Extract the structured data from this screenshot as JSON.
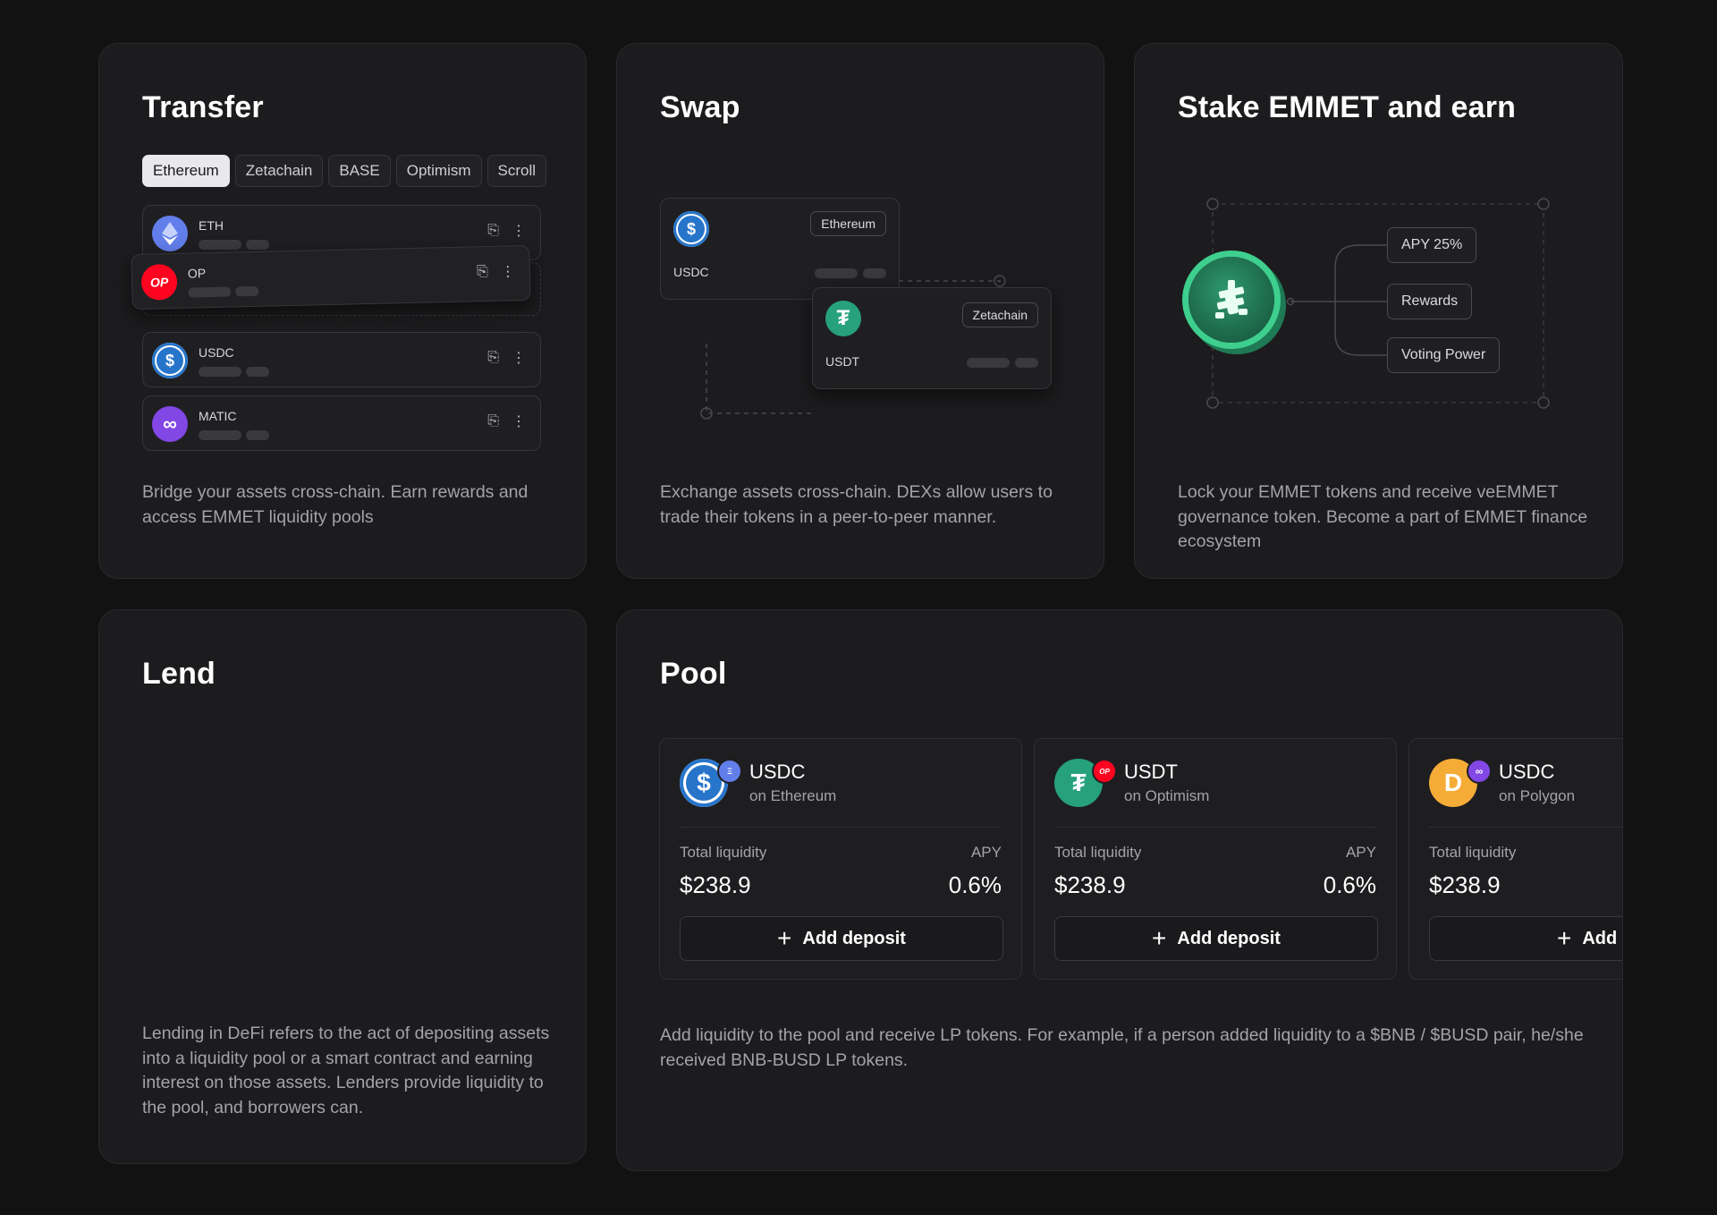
{
  "transfer": {
    "title": "Transfer",
    "tabs": [
      "Ethereum",
      "Zetachain",
      "BASE",
      "Optimism",
      "Scroll"
    ],
    "tokens": [
      {
        "symbol": "ETH",
        "logo": "Ξ"
      },
      {
        "symbol": "OP",
        "logo": "OP"
      },
      {
        "symbol": "USDC",
        "logo": "$"
      },
      {
        "symbol": "MATIC",
        "logo": "∞"
      }
    ],
    "description": "Bridge your assets cross-chain. Earn rewards and access EMMET liquidity pools"
  },
  "swap": {
    "title": "Swap",
    "from": {
      "symbol": "USDC",
      "network": "Ethereum",
      "logo": "$"
    },
    "to": {
      "symbol": "USDT",
      "network": "Zetachain",
      "logo": "₮"
    },
    "description": "Exchange assets cross-chain. DEXs allow users to trade their tokens in a peer-to-peer manner."
  },
  "stake": {
    "title": "Stake EMMET and earn",
    "benefits": [
      "APY 25%",
      "Rewards",
      "Voting Power"
    ],
    "description": "Lock your EMMET tokens and receive veEMMET governance token. Become a part of EMMET finance ecosystem"
  },
  "lend": {
    "title": "Lend",
    "description": "Lending in DeFi refers to the act of depositing assets into a liquidity pool or a smart contract and earning interest on those assets. Lenders provide liquidity to the pool, and borrowers can."
  },
  "pool": {
    "title": "Pool",
    "pools": [
      {
        "symbol": "USDC",
        "network": "on Ethereum",
        "liquidity_label": "Total liquidity",
        "liquidity": "$238.9",
        "apy_label": "APY",
        "apy": "0.6%",
        "button": "Add deposit",
        "logo": "$"
      },
      {
        "symbol": "USDT",
        "network": "on Optimism",
        "liquidity_label": "Total liquidity",
        "liquidity": "$238.9",
        "apy_label": "APY",
        "apy": "0.6%",
        "button": "Add deposit",
        "logo": "₮",
        "badge": "OP"
      },
      {
        "symbol": "USDC",
        "network": "on Polygon",
        "liquidity_label": "Total liquidity",
        "liquidity": "$238.9",
        "button": "Add",
        "logo": "D"
      }
    ],
    "description": "Add liquidity to the pool and receive LP tokens. For example, if a person added liquidity to a $BNB / $BUSD pair, he/she received BNB-BUSD LP tokens."
  },
  "colors": {
    "background": "#121213",
    "card": "#1c1c1e",
    "eth": "#627eea",
    "op": "#ff0420",
    "usdc": "#2775ca",
    "matic": "#8247e5",
    "usdt": "#26a17b",
    "dai": "#f5ac37",
    "emmet": "#3ecf8e"
  }
}
